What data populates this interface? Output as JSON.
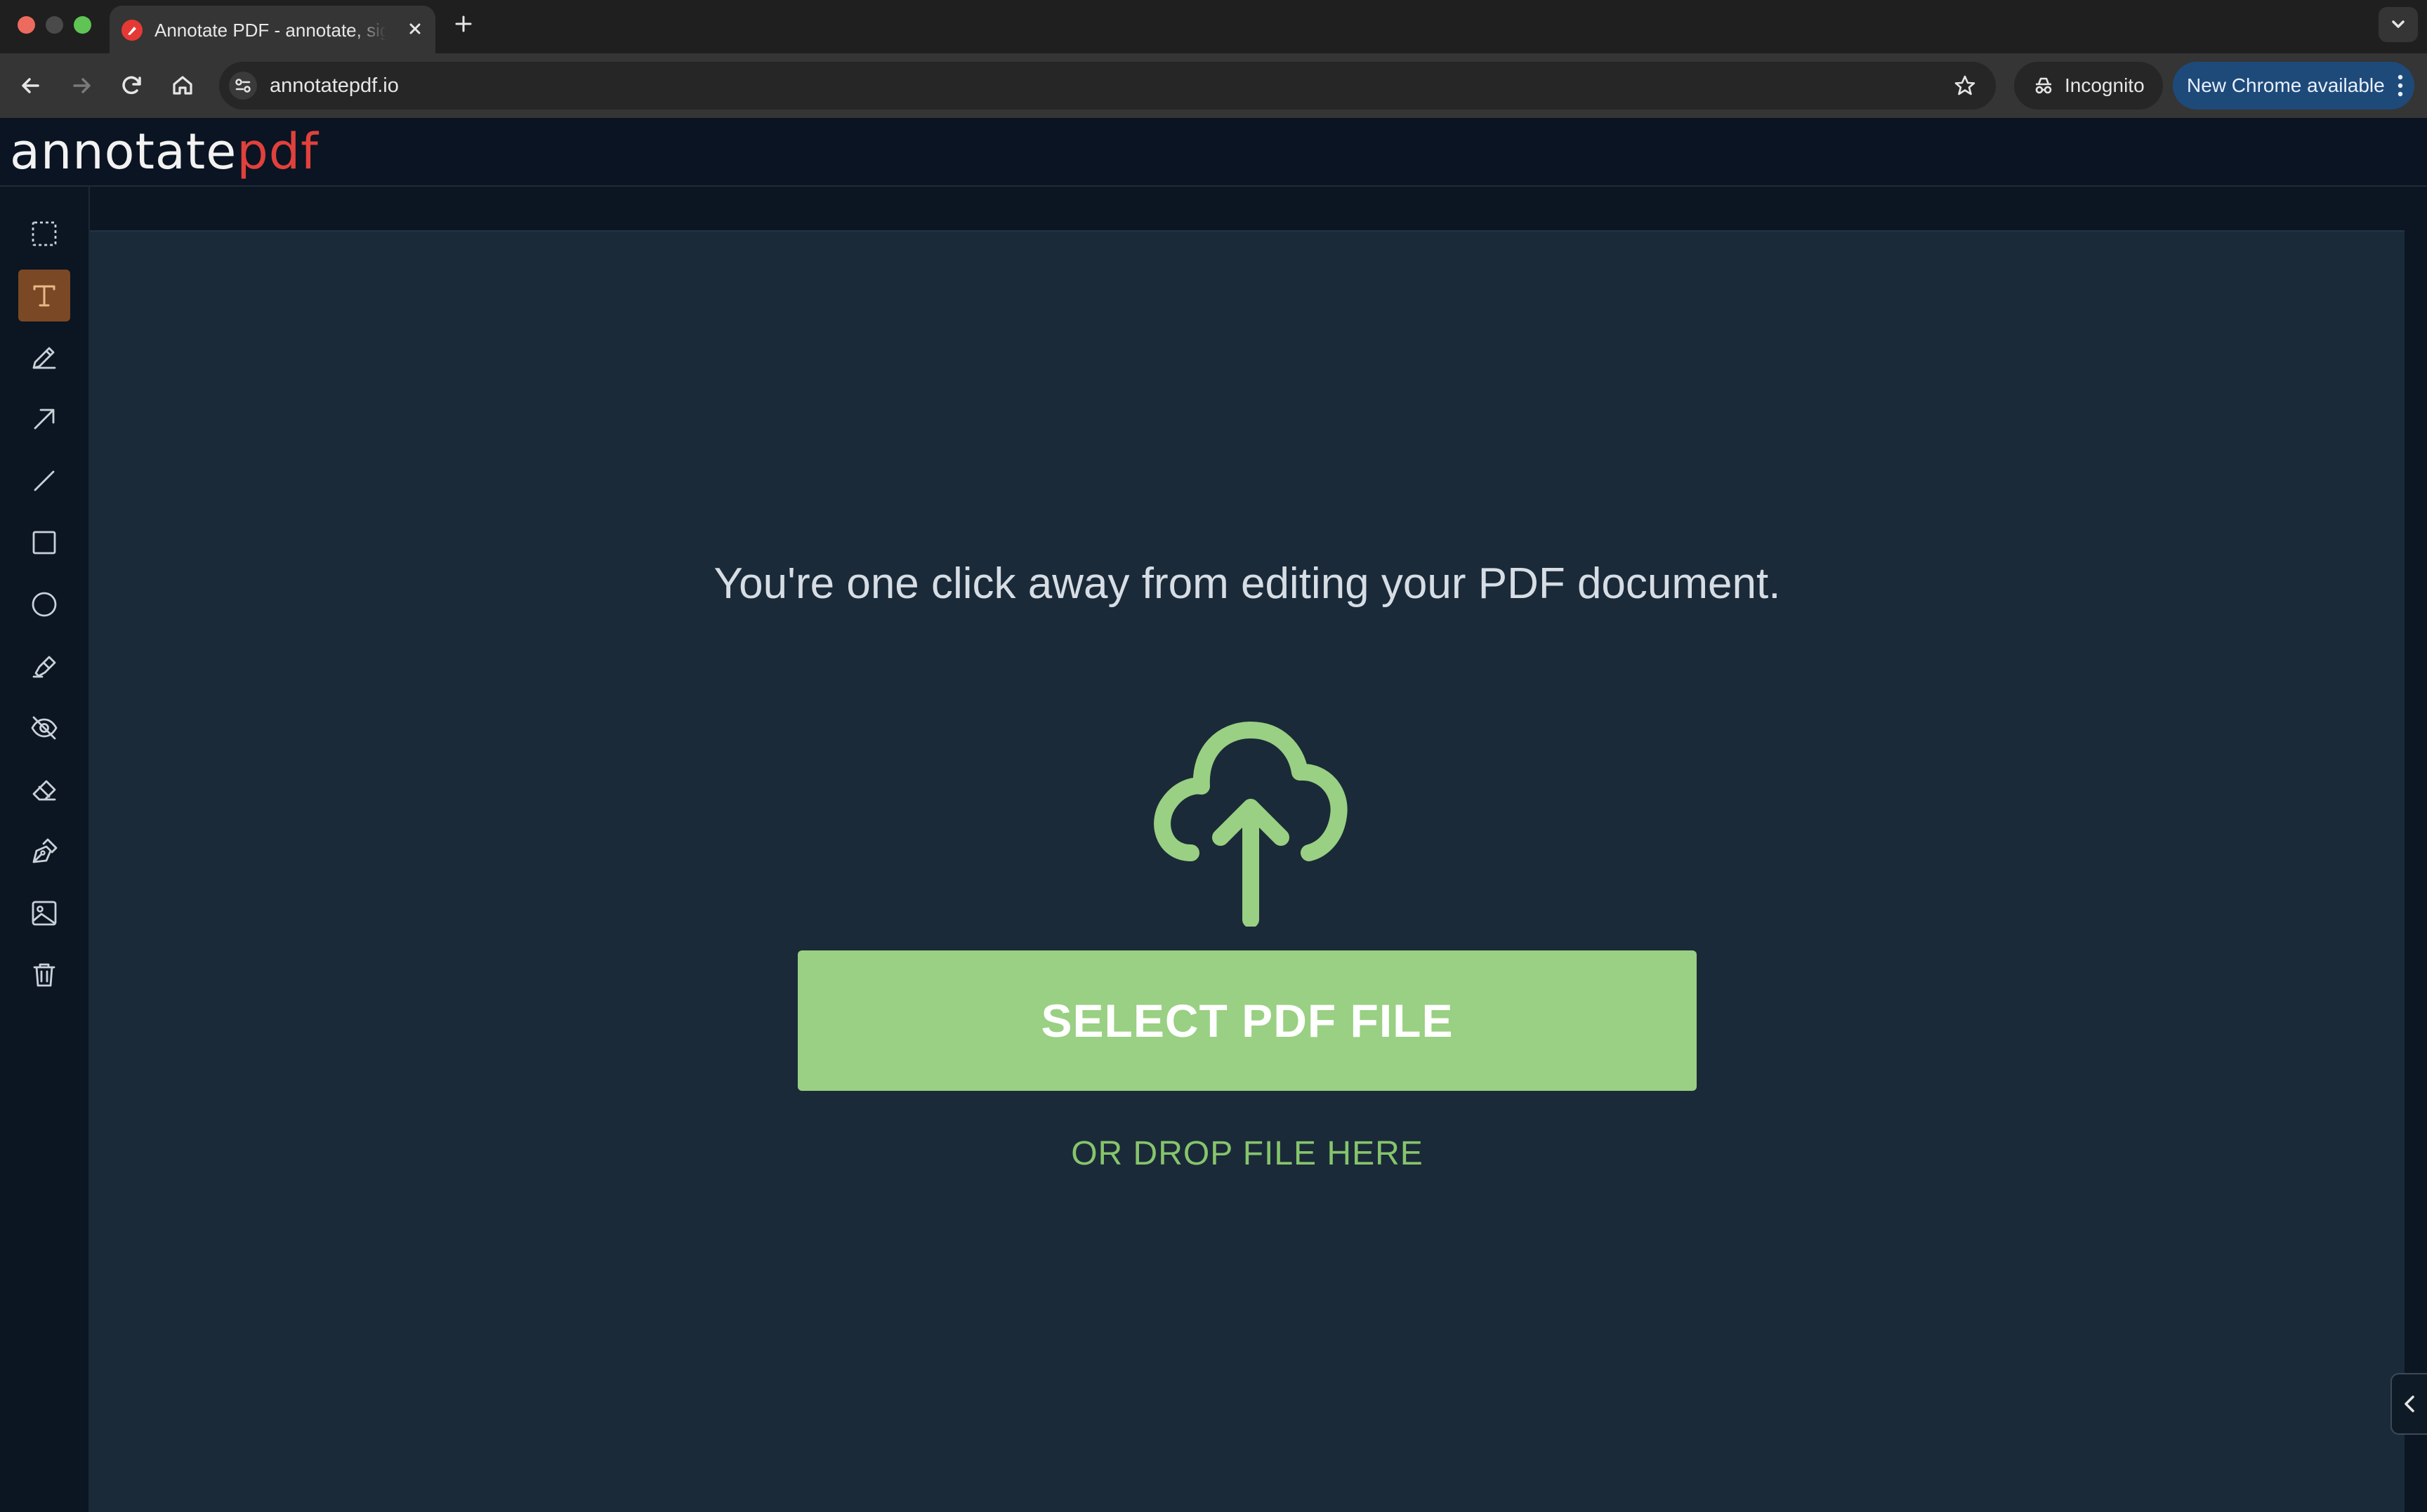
{
  "browser": {
    "tab_title": "Annotate PDF - annotate, sign",
    "url": "annotatepdf.io",
    "incognito_label": "Incognito",
    "update_label": "New Chrome available"
  },
  "app": {
    "logo_part1": "annotate",
    "logo_part2": "pdf"
  },
  "tools": [
    {
      "name": "select-tool",
      "icon": "dashed-rectangle-icon"
    },
    {
      "name": "text-tool",
      "icon": "text-icon",
      "active": true
    },
    {
      "name": "pencil-tool",
      "icon": "pencil-icon"
    },
    {
      "name": "arrow-tool",
      "icon": "arrow-icon"
    },
    {
      "name": "line-tool",
      "icon": "line-icon"
    },
    {
      "name": "rectangle-tool",
      "icon": "square-icon"
    },
    {
      "name": "circle-tool",
      "icon": "circle-icon"
    },
    {
      "name": "highlighter-tool",
      "icon": "highlighter-icon"
    },
    {
      "name": "redact-tool",
      "icon": "eye-off-icon"
    },
    {
      "name": "eraser-tool",
      "icon": "eraser-icon"
    },
    {
      "name": "signature-tool",
      "icon": "pen-nib-icon"
    },
    {
      "name": "image-tool",
      "icon": "image-icon"
    },
    {
      "name": "delete-tool",
      "icon": "trash-icon"
    }
  ],
  "main": {
    "headline": "You're one click away from editing your PDF document.",
    "select_button": "SELECT PDF FILE",
    "drop_text": "OR DROP FILE HERE"
  },
  "colors": {
    "accent_green": "#99d083",
    "active_tool": "#7a4824",
    "logo_red": "#e0413c"
  }
}
